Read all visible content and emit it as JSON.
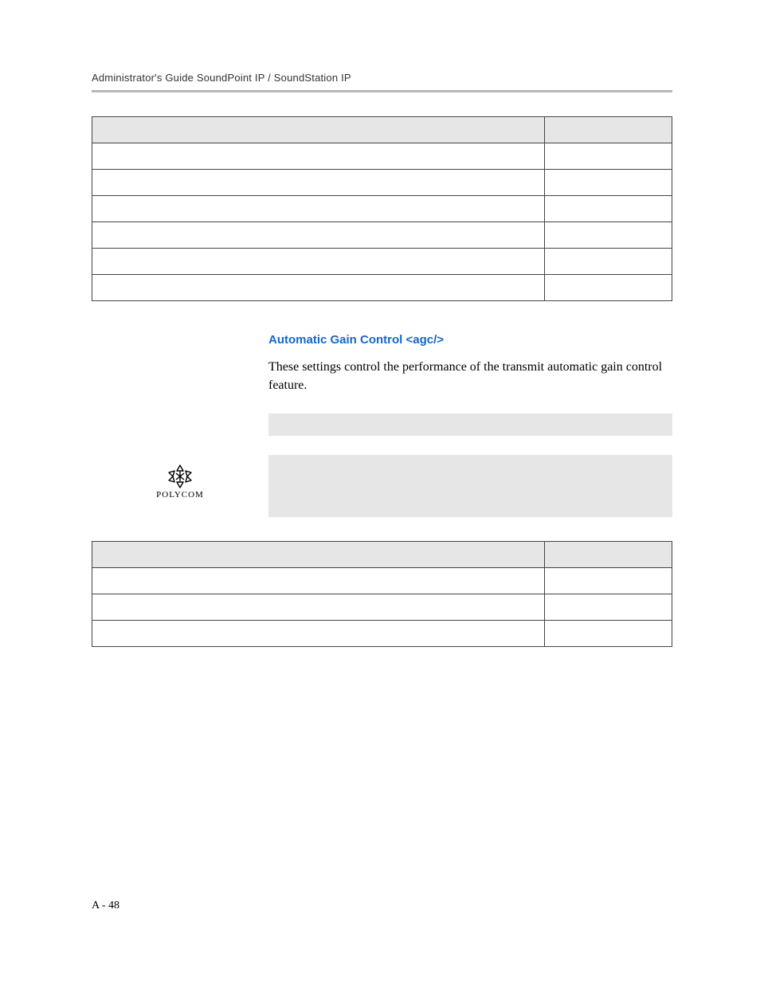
{
  "header": {
    "running_title": "Administrator's Guide SoundPoint IP / SoundStation IP"
  },
  "section": {
    "title": "Automatic Gain Control <agc/>",
    "paragraph": "These settings control the performance of the transmit automatic gain control feature."
  },
  "logo": {
    "caption": "POLYCOM"
  },
  "footer": {
    "page_number": "A - 48"
  }
}
